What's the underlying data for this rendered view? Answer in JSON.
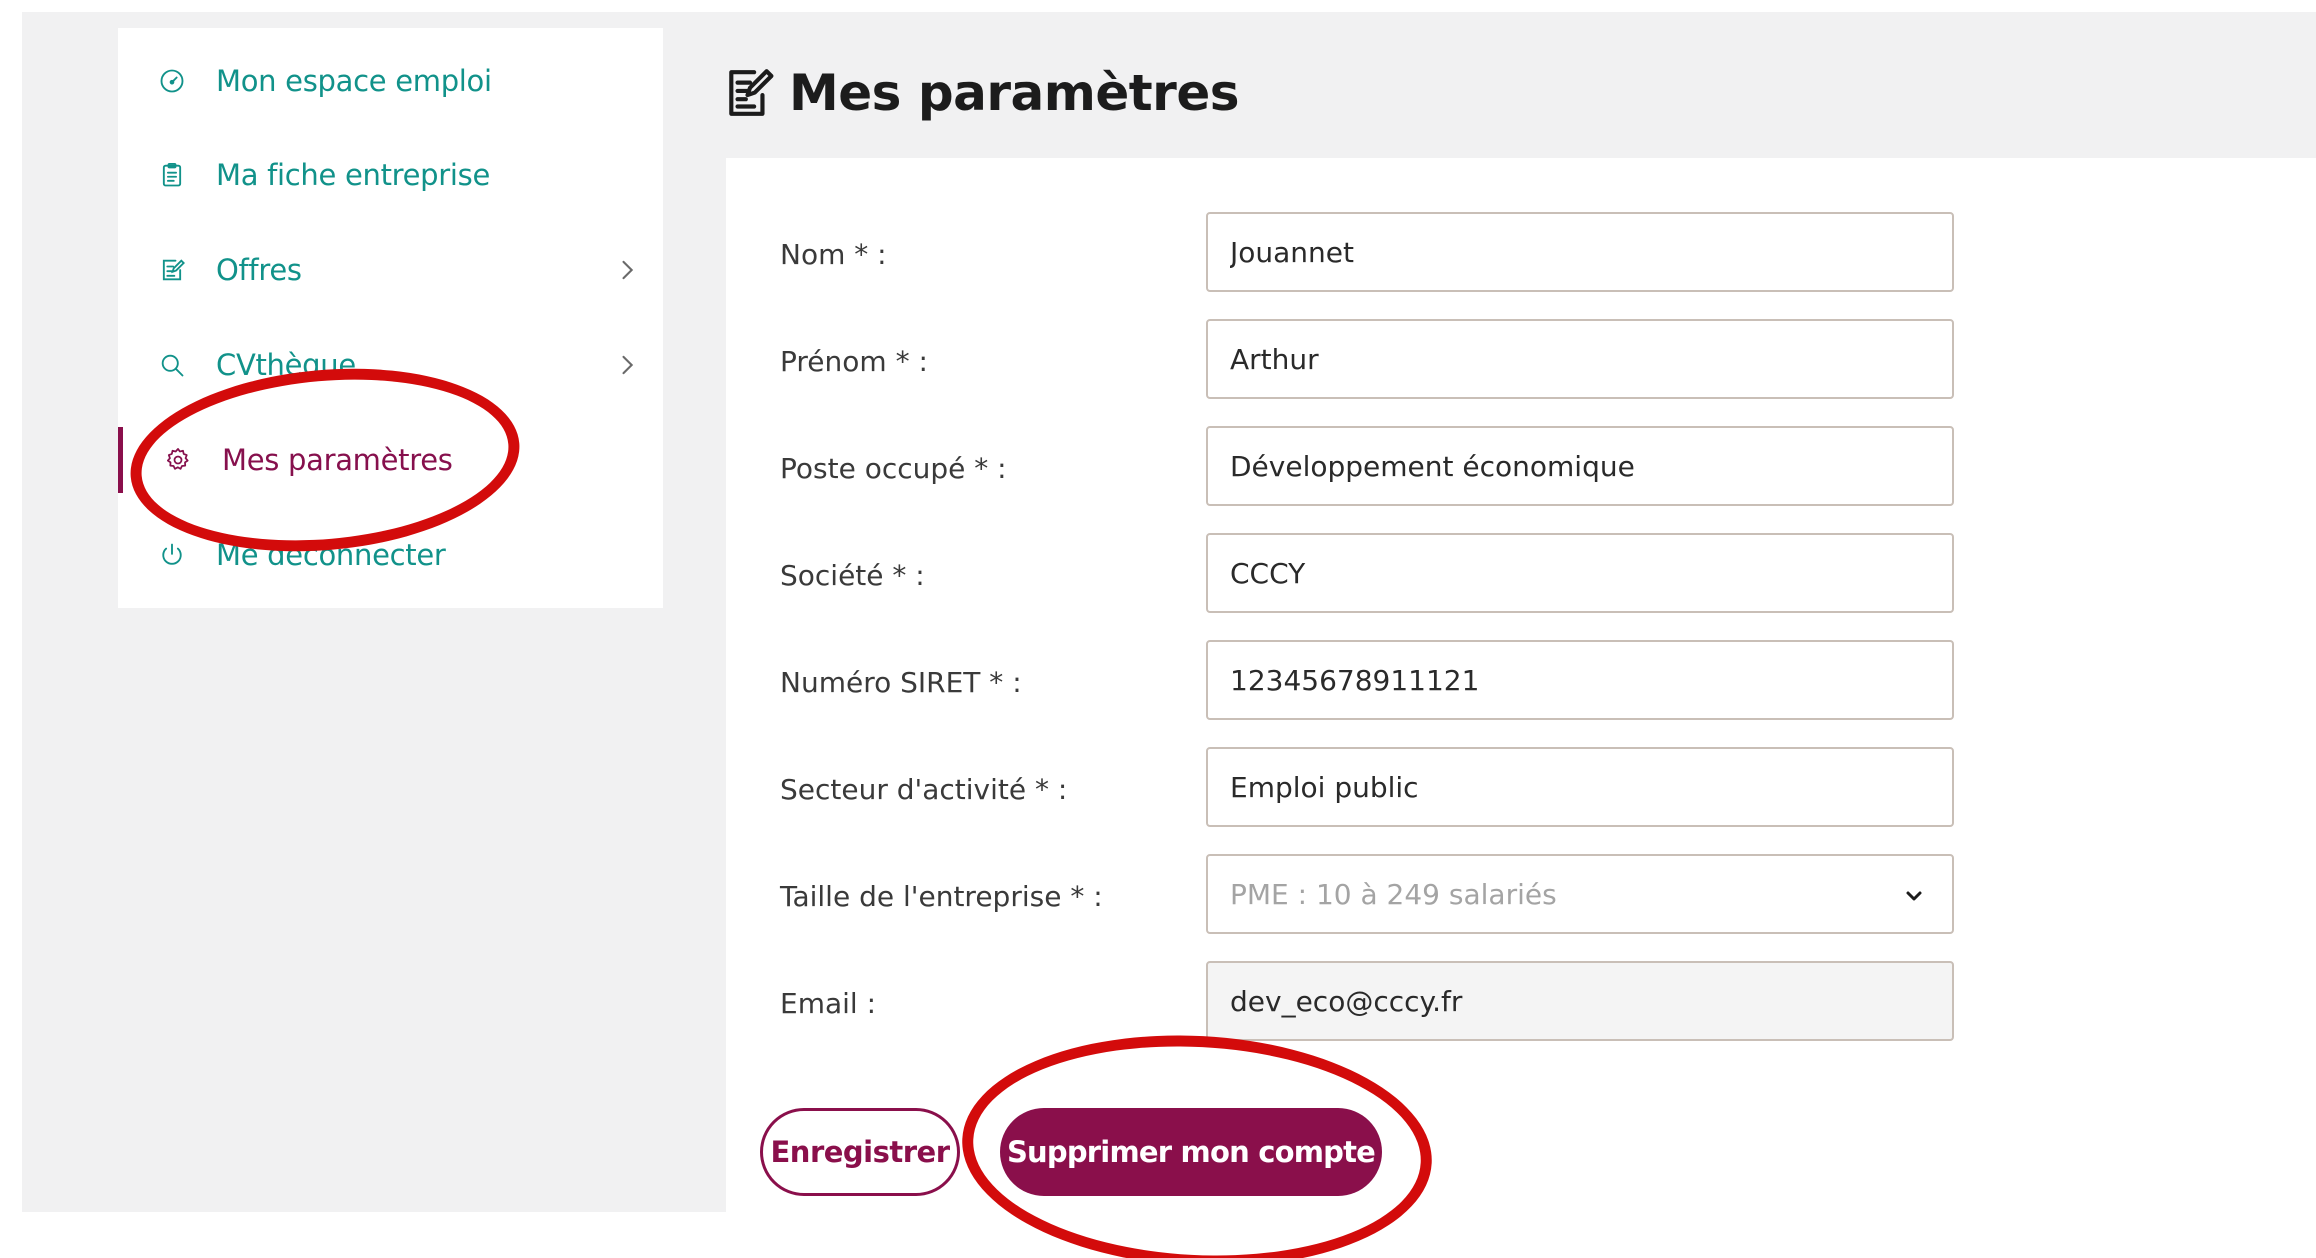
{
  "sidebar": {
    "items": [
      {
        "label": "Mon espace emploi",
        "icon": "dashboard-gauge-icon"
      },
      {
        "label": "Ma fiche entreprise",
        "icon": "clipboard-icon"
      },
      {
        "label": "Offres",
        "icon": "edit-document-icon",
        "chevron": "chevron-right-icon"
      },
      {
        "label": "CVthèque",
        "icon": "search-icon",
        "chevron": "chevron-right-icon"
      },
      {
        "label": "Mes paramètres",
        "icon": "gear-icon",
        "active": true
      },
      {
        "label": "Me déconnecter",
        "icon": "power-icon"
      }
    ]
  },
  "header": {
    "title": "Mes paramètres",
    "icon": "edit-document-icon"
  },
  "form": {
    "nom": {
      "label": "Nom * :",
      "value": "Jouannet"
    },
    "prenom": {
      "label": "Prénom * :",
      "value": "Arthur"
    },
    "poste": {
      "label": "Poste occupé * :",
      "value": "Développement économique"
    },
    "societe": {
      "label": "Société * :",
      "value": "CCCY"
    },
    "siret": {
      "label": "Numéro SIRET * :",
      "value": "12345678911121"
    },
    "secteur": {
      "label": "Secteur d'activité * :",
      "value": "Emploi public"
    },
    "taille": {
      "label": "Taille de l'entreprise * :",
      "value": "PME : 10 à 249 salariés"
    },
    "email": {
      "label": "Email :",
      "value": "dev_eco@cccy.fr"
    }
  },
  "actions": {
    "save_label": "Enregistrer",
    "delete_label": "Supprimer mon compte"
  },
  "colors": {
    "accent_teal": "#11928a",
    "brand_burgundy": "#8a0f4b",
    "annotation_red": "#d30b0b",
    "page_bg": "#f1f1f2"
  }
}
